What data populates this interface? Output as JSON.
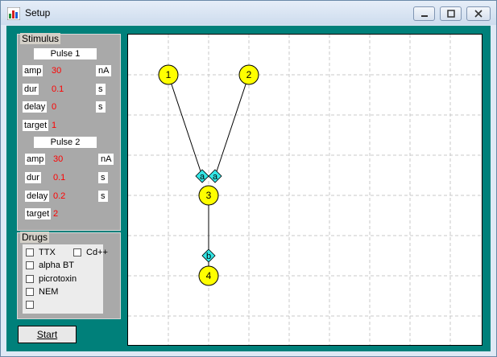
{
  "window": {
    "title": "Setup"
  },
  "stimulus": {
    "group_label": "Stimulus",
    "pulses": [
      {
        "header": "Pulse 1",
        "amp_label": "amp",
        "amp": "30",
        "amp_unit": "nA",
        "dur_label": "dur",
        "dur": "0.1",
        "dur_unit": "s",
        "delay_label": "delay",
        "delay": "0",
        "delay_unit": "s",
        "target_label": "target",
        "target": "1"
      },
      {
        "header": "Pulse 2",
        "amp_label": "amp",
        "amp": "30",
        "amp_unit": "nA",
        "dur_label": "dur",
        "dur": "0.1",
        "dur_unit": "s",
        "delay_label": "delay",
        "delay": "0.2",
        "delay_unit": "s",
        "target_label": "target",
        "target": "2"
      }
    ]
  },
  "drugs": {
    "group_label": "Drugs",
    "items": [
      {
        "label": "TTX",
        "checked": false
      },
      {
        "label": "Cd++",
        "checked": false
      },
      {
        "label": "alpha BT",
        "checked": false
      },
      {
        "label": "picrotoxin",
        "checked": false
      },
      {
        "label": "NEM",
        "checked": false
      },
      {
        "label": "",
        "checked": false
      }
    ]
  },
  "start_button": {
    "label": "Start"
  },
  "network": {
    "neurons": [
      {
        "id": "1",
        "label": "1"
      },
      {
        "id": "2",
        "label": "2"
      },
      {
        "id": "3",
        "label": "3"
      },
      {
        "id": "4",
        "label": "4"
      }
    ],
    "synapses": [
      {
        "label": "a",
        "from": "1",
        "to": "3"
      },
      {
        "label": "a",
        "from": "2",
        "to": "3"
      },
      {
        "label": "b",
        "from": "4",
        "to": "3"
      }
    ],
    "colors": {
      "neuron": "#ffff00",
      "synapse": "#33e6e6",
      "grid": "#c8c8c8"
    }
  }
}
